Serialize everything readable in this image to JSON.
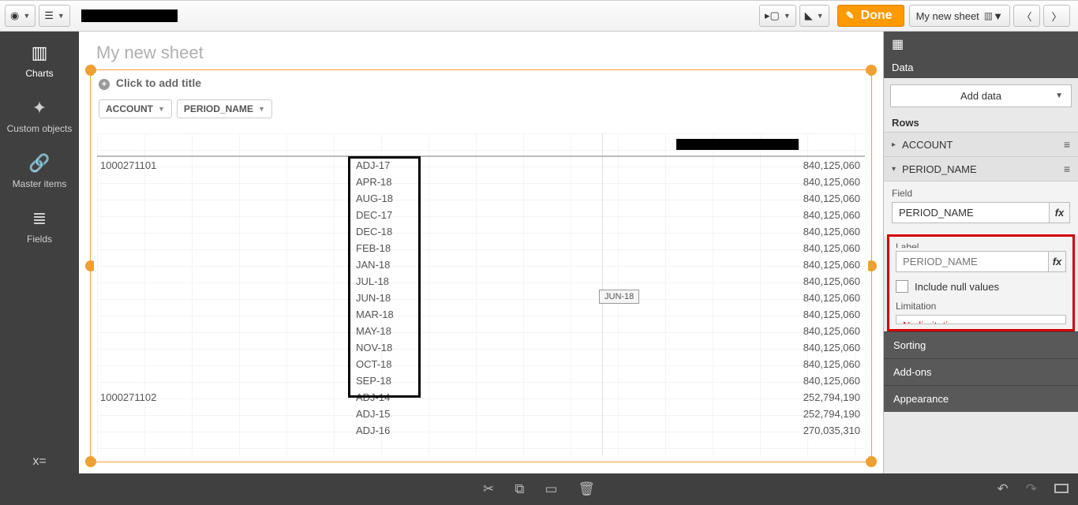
{
  "topbar": {
    "done_label": "Done",
    "sheet_dropdown_label": "My new sheet"
  },
  "leftbar": {
    "items": [
      {
        "label": "Charts"
      },
      {
        "label": "Custom objects"
      },
      {
        "label": "Master items"
      },
      {
        "label": "Fields"
      }
    ]
  },
  "sheet": {
    "title": "My new sheet",
    "add_title_hint": "Click to add title",
    "dimension_pills": [
      "ACCOUNT",
      "PERIOD_NAME"
    ],
    "hover_tag": "JUN-18",
    "rows": [
      {
        "account": "1000271101",
        "period": "ADJ-17",
        "value": "840,125,060"
      },
      {
        "account": "",
        "period": "APR-18",
        "value": "840,125,060"
      },
      {
        "account": "",
        "period": "AUG-18",
        "value": "840,125,060"
      },
      {
        "account": "",
        "period": "DEC-17",
        "value": "840,125,060"
      },
      {
        "account": "",
        "period": "DEC-18",
        "value": "840,125,060"
      },
      {
        "account": "",
        "period": "FEB-18",
        "value": "840,125,060"
      },
      {
        "account": "",
        "period": "JAN-18",
        "value": "840,125,060"
      },
      {
        "account": "",
        "period": "JUL-18",
        "value": "840,125,060"
      },
      {
        "account": "",
        "period": "JUN-18",
        "value": "840,125,060"
      },
      {
        "account": "",
        "period": "MAR-18",
        "value": "840,125,060"
      },
      {
        "account": "",
        "period": "MAY-18",
        "value": "840,125,060"
      },
      {
        "account": "",
        "period": "NOV-18",
        "value": "840,125,060"
      },
      {
        "account": "",
        "period": "OCT-18",
        "value": "840,125,060"
      },
      {
        "account": "",
        "period": "SEP-18",
        "value": "840,125,060"
      },
      {
        "account": "1000271102",
        "period": "ADJ-14",
        "value": "252,794,190"
      },
      {
        "account": "",
        "period": "ADJ-15",
        "value": "252,794,190"
      },
      {
        "account": "",
        "period": "ADJ-16",
        "value": "270,035,310"
      }
    ]
  },
  "props": {
    "data_header": "Data",
    "add_data_label": "Add data",
    "rows_header": "Rows",
    "row_account": "ACCOUNT",
    "row_period": "PERIOD_NAME",
    "field_label": "Field",
    "field_value": "PERIOD_NAME",
    "label_label": "Label",
    "label_placeholder": "PERIOD_NAME",
    "include_null_label": "Include null values",
    "limitation_label": "Limitation",
    "limitation_value": "No limitation",
    "sorting": "Sorting",
    "addons": "Add-ons",
    "appearance": "Appearance"
  }
}
